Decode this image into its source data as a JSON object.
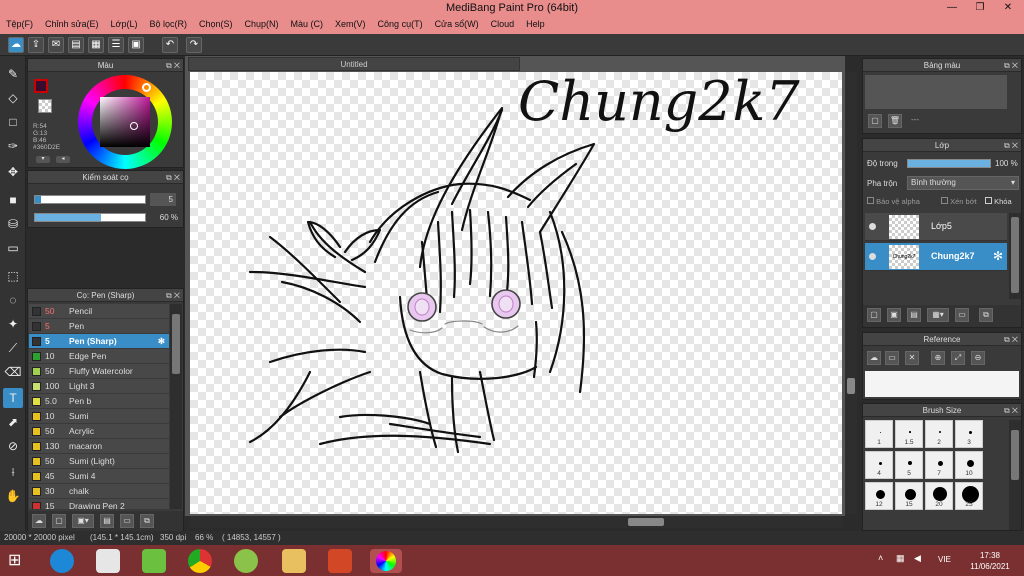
{
  "window": {
    "title": "MediBang Paint Pro (64bit)"
  },
  "menu": [
    "Tệp(F)",
    "Chỉnh sửa(E)",
    "Lớp(L)",
    "Bộ lọc(R)",
    "Chọn(S)",
    "Chụp(N)",
    "Màu (C)",
    "Xem(V)",
    "Công cụ(T)",
    "Cửa sổ(W)",
    "Cloud",
    "Help"
  ],
  "color_panel": {
    "title": "Màu",
    "r": "R:54",
    "g": "G:13",
    "b": "B:46",
    "hex": "#360D2E",
    "fg_color": "#360D2E"
  },
  "brush_control": {
    "title": "Kiểm soát cọ",
    "size": "5",
    "opacity": "60 %",
    "opacity_value": 0.6
  },
  "brush_list": {
    "title": "Cọ: Pen (Sharp)",
    "items": [
      {
        "size": "50",
        "name": "Pencil",
        "color": "#333333"
      },
      {
        "size": "5",
        "name": "Pen",
        "color": "#333333"
      },
      {
        "size": "5",
        "name": "Pen (Sharp)",
        "color": "#333333",
        "selected": true
      },
      {
        "size": "10",
        "name": "Edge Pen",
        "color": "#2ea02e"
      },
      {
        "size": "50",
        "name": "Fluffy Watercolor",
        "color": "#a0d050"
      },
      {
        "size": "100",
        "name": "Light 3",
        "color": "#c8e070"
      },
      {
        "size": "5.0",
        "name": "Pen b",
        "color": "#e0e040"
      },
      {
        "size": "10",
        "name": "Sumi",
        "color": "#e8c020"
      },
      {
        "size": "50",
        "name": "Acrylic",
        "color": "#e8c020"
      },
      {
        "size": "130",
        "name": "macaron",
        "color": "#e8c020"
      },
      {
        "size": "50",
        "name": "Sumi (Light)",
        "color": "#e8c020"
      },
      {
        "size": "45",
        "name": "Sumi 4",
        "color": "#e8c020"
      },
      {
        "size": "30",
        "name": "chalk",
        "color": "#e8c020"
      },
      {
        "size": "15",
        "name": "Drawing Pen 2",
        "color": "#d03030"
      }
    ]
  },
  "canvas": {
    "tab": "Untitled",
    "watermark": "Chung2k7"
  },
  "palette_panel": {
    "title": "Bảng màu",
    "value": "---"
  },
  "layer_panel": {
    "title": "Lớp",
    "opacity_label": "Độ trong",
    "opacity": "100 %",
    "opacity_value": 1.0,
    "blend_label": "Pha trộn",
    "blend": "Bình thường",
    "protect_alpha": "Bảo vệ alpha",
    "clipping": "Xén bớt",
    "lock": "Khóa",
    "layers": [
      {
        "name": "Lớp5",
        "thumb": "",
        "selected": false
      },
      {
        "name": "Chung2k7",
        "thumb": "Chung2k7",
        "selected": true
      }
    ]
  },
  "reference_panel": {
    "title": "Reference"
  },
  "brush_size_panel": {
    "title": "Brush Size",
    "sizes": [
      "1",
      "1.5",
      "2",
      "3",
      "4",
      "5",
      "7",
      "10",
      "12",
      "15",
      "20",
      "25"
    ]
  },
  "status": {
    "dimensions": "20000 * 20000 pixel",
    "physical": "(145.1 * 145.1cm)",
    "dpi": "350 dpi",
    "zoom": "66 %",
    "coords": "( 14853, 14557 )"
  },
  "taskbar": {
    "time": "17:38",
    "date": "11/06/2021",
    "lang": "VIE"
  },
  "colors": {
    "accent": "#3a8ec8",
    "title": "#e88c8c",
    "taskbar": "#7a3030"
  }
}
